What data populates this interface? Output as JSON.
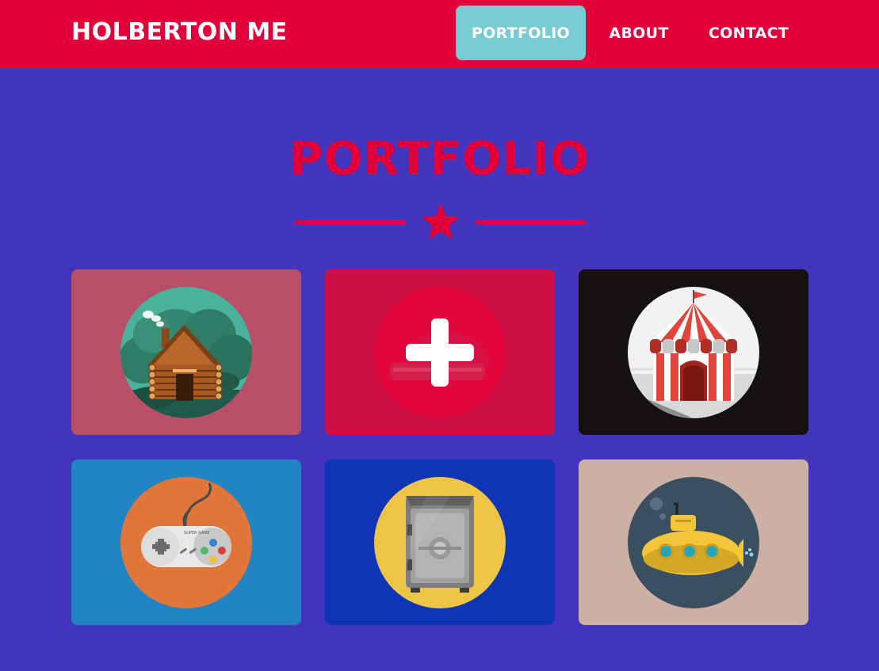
{
  "navbar": {
    "brand": "HOLBERTON ME",
    "links": [
      {
        "label": "PORTFOLIO",
        "active": true
      },
      {
        "label": "ABOUT",
        "active": false
      },
      {
        "label": "CONTACT",
        "active": false
      }
    ]
  },
  "section": {
    "title": "PORTFOLIO",
    "divider_icon": "star-icon"
  },
  "portfolio": {
    "items": [
      {
        "icon": "log-cabin-icon",
        "bg": "#b84f66"
      },
      {
        "icon": "cake-with-plus-icon",
        "bg": "#cc1044"
      },
      {
        "icon": "circus-tent-icon",
        "bg": "#151111"
      },
      {
        "icon": "game-controller-icon",
        "bg": "#2184c3"
      },
      {
        "icon": "safe-icon",
        "bg": "#0f35b5"
      },
      {
        "icon": "submarine-icon",
        "bg": "#cbb0a3"
      }
    ]
  },
  "colors": {
    "page_bg": "#4234bd",
    "accent": "#e10039",
    "active_nav": "#78cbd1"
  }
}
